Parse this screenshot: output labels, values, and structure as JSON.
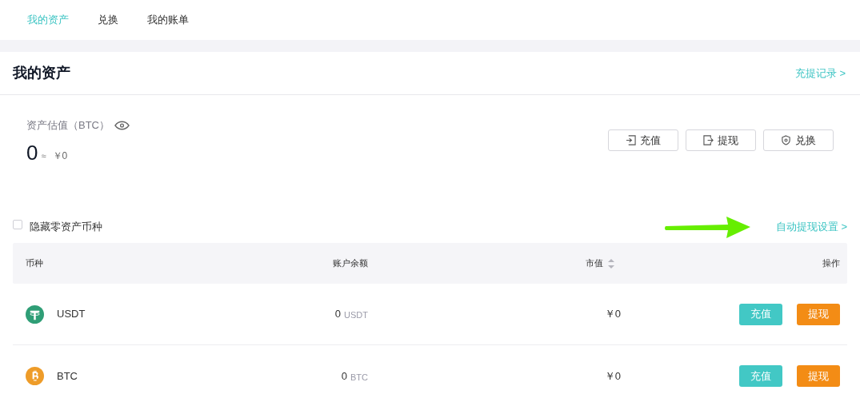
{
  "tabs": [
    {
      "label": "我的资产",
      "selected": true
    },
    {
      "label": "兑换",
      "selected": false
    },
    {
      "label": "我的账单",
      "selected": false
    }
  ],
  "header": {
    "title": "我的资产",
    "link": "充提记录 >"
  },
  "summary": {
    "label": "资产估值（BTC）",
    "value": "0",
    "approx": "≈",
    "fiat": "￥0"
  },
  "actions": [
    {
      "kind": "deposit",
      "label": "充值"
    },
    {
      "kind": "withdraw",
      "label": "提现"
    },
    {
      "kind": "exchange",
      "label": "兑换"
    }
  ],
  "filter": {
    "label": "隐藏零资产币种",
    "checked": false
  },
  "auto_link": "自动提现设置 >",
  "table": {
    "columns": [
      "币种",
      "账户余额",
      "市值",
      "操作"
    ],
    "rows": [
      {
        "kind": "usdt",
        "coin": "USDT",
        "amount": "0",
        "unit": "USDT",
        "value": "￥0",
        "buttons": [
          "充值",
          "提现"
        ]
      },
      {
        "kind": "btc",
        "coin": "BTC",
        "amount": "0",
        "unit": "BTC",
        "value": "￥0",
        "buttons": [
          "充值",
          "提现"
        ]
      }
    ]
  }
}
